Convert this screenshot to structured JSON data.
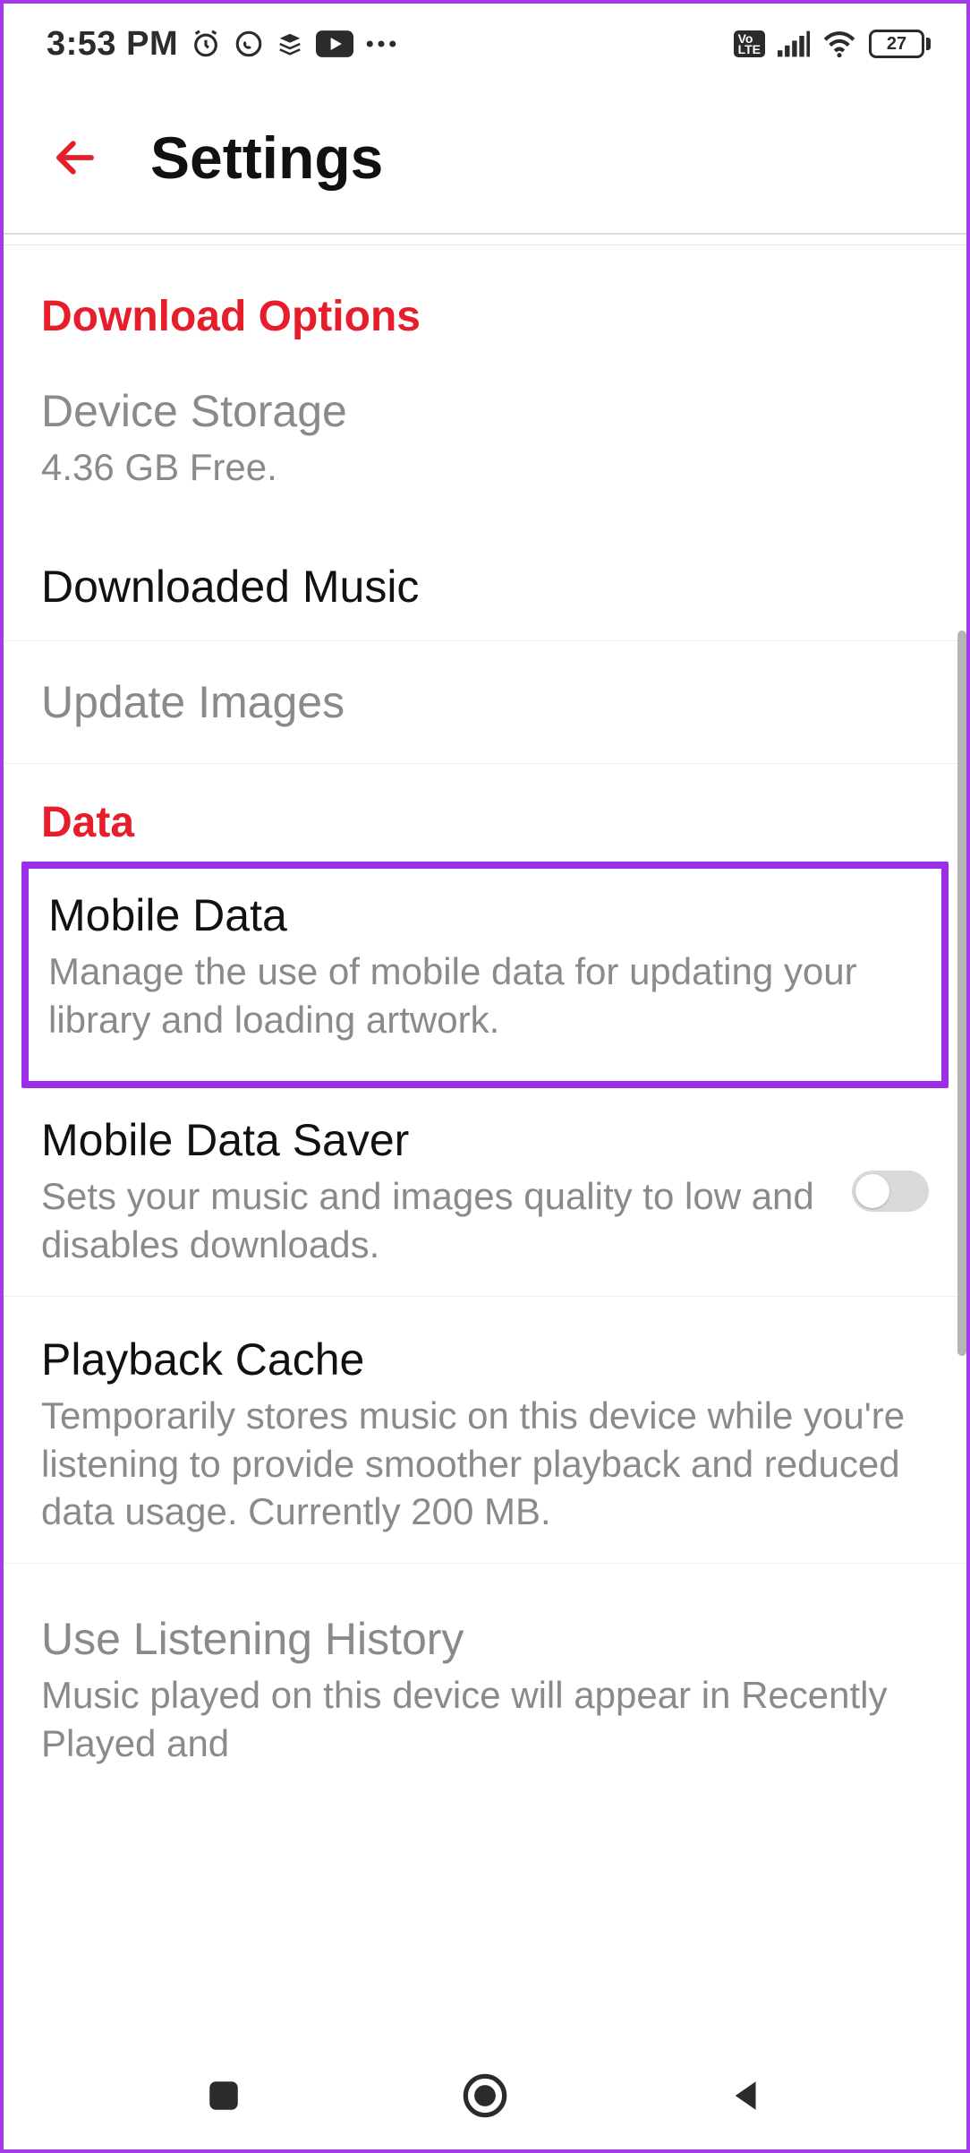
{
  "status": {
    "time": "3:53 PM",
    "battery_pct": "27",
    "icons_left": [
      "alarm",
      "whatsapp",
      "layers",
      "youtube",
      "more"
    ],
    "icons_right": [
      "volte",
      "signal",
      "wifi",
      "battery"
    ]
  },
  "header": {
    "title": "Settings"
  },
  "sections": {
    "download_options": {
      "header": "Download Options",
      "device_storage": {
        "title": "Device Storage",
        "sub": "4.36 GB Free."
      },
      "downloaded_music": {
        "title": "Downloaded Music"
      },
      "update_images": {
        "title": "Update Images"
      }
    },
    "data": {
      "header": "Data",
      "mobile_data": {
        "title": "Mobile Data",
        "sub": "Manage the use of mobile data for updating your library and loading artwork."
      },
      "mobile_data_saver": {
        "title": "Mobile Data Saver",
        "sub": "Sets your music and images quality to low and disables downloads.",
        "toggle": false
      },
      "playback_cache": {
        "title": "Playback Cache",
        "sub": "Temporarily stores music on this device while you're listening to provide smoother playback and reduced data usage. Currently 200 MB."
      },
      "listening_history": {
        "title": "Use Listening History",
        "sub": "Music played on this device will appear in Recently Played and"
      }
    }
  },
  "colors": {
    "accent": "#e61e2b",
    "highlight": "#9b2ee6"
  }
}
